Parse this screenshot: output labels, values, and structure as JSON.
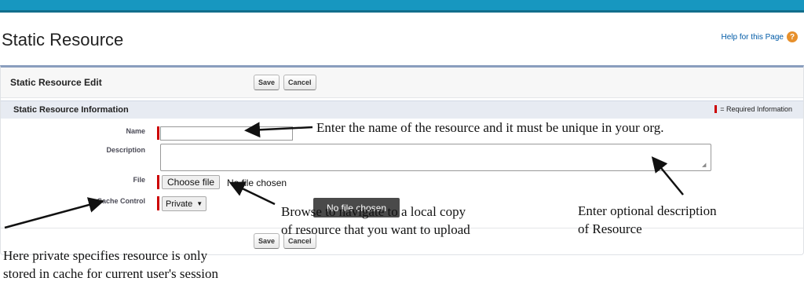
{
  "page": {
    "title": "Static Resource",
    "help_link": "Help for this Page",
    "help_icon": "question-icon"
  },
  "panel": {
    "title": "Static Resource Edit",
    "save_label": "Save",
    "cancel_label": "Cancel",
    "section_title": "Static Resource Information",
    "required_legend": "= Required Information"
  },
  "fields": {
    "name_label": "Name",
    "name_value": "",
    "description_label": "Description",
    "description_value": "",
    "file_label": "File",
    "file_button": "Choose file",
    "file_status": "No file chosen",
    "cache_label": "Cache Control",
    "cache_value": "Private"
  },
  "tooltip": "No file chosen",
  "annotations": {
    "name_note": "Enter the name of the resource and it must be unique in your org.",
    "browse_note_line1": "Browse to navigate to a local copy",
    "browse_note_line2": "of resource that you want to upload",
    "description_note_line1": "Enter optional description",
    "description_note_line2": "of Resource",
    "cache_note_line1": "Here private specifies resource is only",
    "cache_note_line2": "stored in cache for current user's session"
  },
  "colors": {
    "topbar": "#1797c0",
    "required": "#cc0000",
    "link": "#015ba7",
    "section_bg": "#e7ebf2"
  }
}
